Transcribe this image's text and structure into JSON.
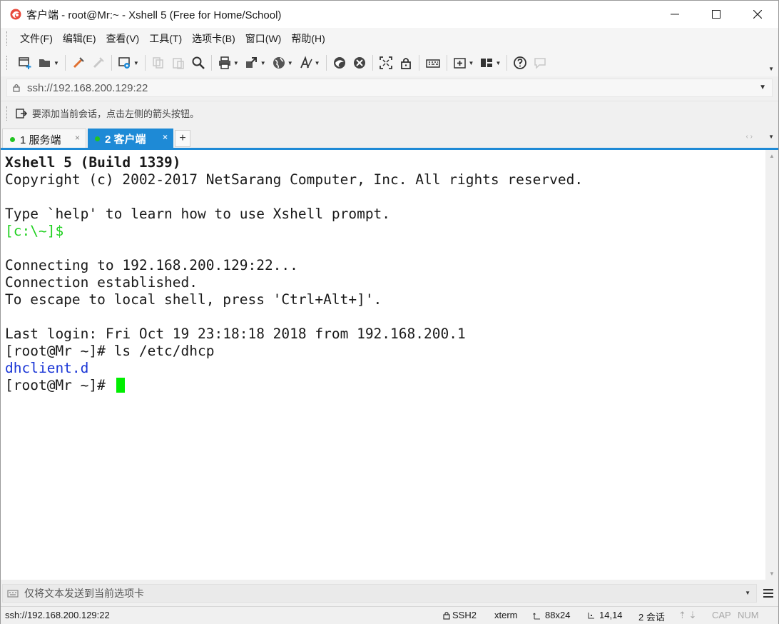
{
  "window": {
    "title": "客户端 - root@Mr:~ - Xshell 5 (Free for Home/School)",
    "controls": {
      "minimize": "—",
      "maximize": "☐",
      "close": "✕"
    }
  },
  "menu": [
    "文件(F)",
    "编辑(E)",
    "查看(V)",
    "工具(T)",
    "选项卡(B)",
    "窗口(W)",
    "帮助(H)"
  ],
  "address": {
    "value": "ssh://192.168.200.129:22",
    "dropdown": "▼"
  },
  "hint": {
    "text": "要添加当前会话，点击左侧的箭头按钮。"
  },
  "tabs": [
    {
      "label": "1 服务端",
      "close": "×",
      "status_color": "#22c322"
    },
    {
      "label": "2 客户端",
      "close": "×",
      "status_color": "#22c322",
      "active": true
    }
  ],
  "tab_add": "+",
  "tab_nav": "‹ ›",
  "terminal": {
    "lines": [
      "Xshell 5 (Build 1339)",
      "Copyright (c) 2002-2017 NetSarang Computer, Inc. All rights reserved.",
      "",
      "Type `help' to learn how to use Xshell prompt.",
      "[c:\\~]$",
      "",
      "Connecting to 192.168.200.129:22...",
      "Connection established.",
      "To escape to local shell, press 'Ctrl+Alt+]'.",
      "",
      "Last login: Fri Oct 19 23:18:18 2018 from 192.168.200.1",
      "[root@Mr ~]# ls /etc/dhcp",
      "dhclient.d",
      "[root@Mr ~]# "
    ],
    "colors": {
      "prompt_local": "#1fd01f",
      "directory": "#1a36d6",
      "cursor": "#00ee00"
    }
  },
  "compose": {
    "placeholder": "仅将文本发送到当前选项卡"
  },
  "status": {
    "connection": "ssh://192.168.200.129:22",
    "protocol": "SSH2",
    "terminal_type": "xterm",
    "size": "88x24",
    "cursor_pos": "14,14",
    "sessions": "2 会话",
    "caps": "CAP",
    "num": "NUM"
  },
  "accent_color": "#1e8ad6"
}
